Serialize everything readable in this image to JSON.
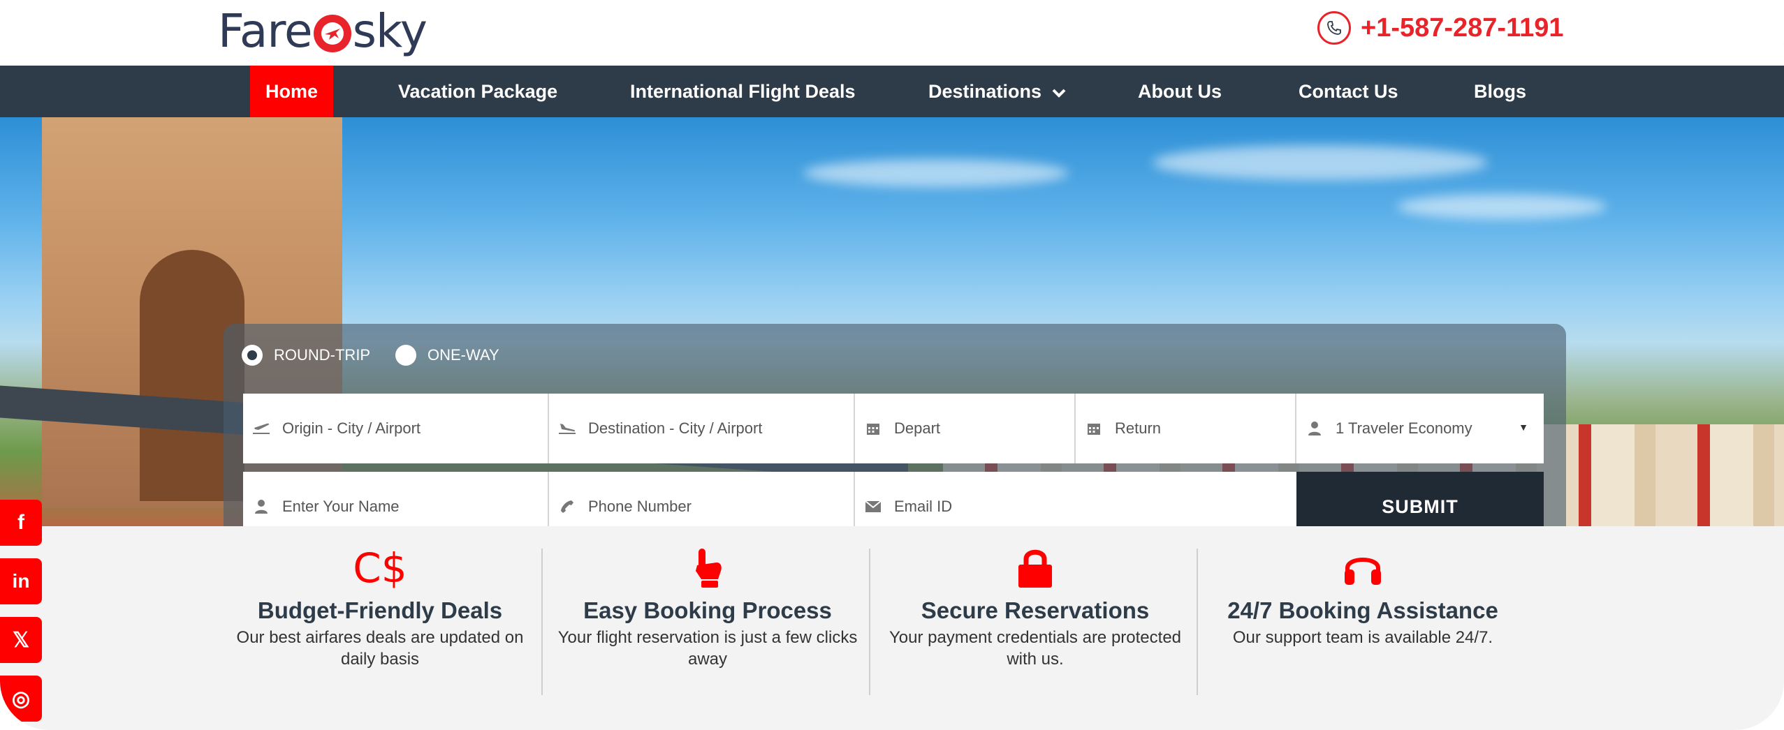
{
  "brand": {
    "logo_left": "Fare",
    "logo_right": "sky"
  },
  "header": {
    "phone": "+1-587-287-1191"
  },
  "nav": {
    "items": [
      {
        "label": "Home",
        "active": true
      },
      {
        "label": "Vacation Package"
      },
      {
        "label": "International Flight Deals"
      },
      {
        "label": "Destinations",
        "has_dropdown": true
      },
      {
        "label": "About Us"
      },
      {
        "label": "Contact Us"
      },
      {
        "label": "Blogs"
      }
    ]
  },
  "search": {
    "trip_types": [
      {
        "label": "ROUND-TRIP",
        "selected": true
      },
      {
        "label": "ONE-WAY",
        "selected": false
      }
    ],
    "origin_placeholder": "Origin - City / Airport",
    "destination_placeholder": "Destination - City / Airport",
    "depart_placeholder": "Depart",
    "return_placeholder": "Return",
    "travelers_value": "1 Traveler Economy",
    "name_placeholder": "Enter Your Name",
    "phone_placeholder": "Phone Number",
    "email_placeholder": "Email ID",
    "submit_label": "SUBMIT"
  },
  "social": [
    {
      "icon": "facebook-icon",
      "glyph": "f"
    },
    {
      "icon": "linkedin-icon",
      "glyph": "in"
    },
    {
      "icon": "x-icon",
      "glyph": "𝕏"
    },
    {
      "icon": "instagram-icon",
      "glyph": "◎"
    }
  ],
  "features": [
    {
      "icon_text": "C$",
      "title": "Budget-Friendly Deals",
      "desc": "Our best airfares deals are updated on daily basis"
    },
    {
      "title": "Easy Booking Process",
      "desc": "Your flight reservation is just a few clicks away"
    },
    {
      "title": "Secure Reservations",
      "desc": "Your payment credentials are protected with us."
    },
    {
      "title": "24/7 Booking Assistance",
      "desc": "Our support team is available 24/7."
    }
  ],
  "colors": {
    "accent": "#ff0000",
    "nav_bg": "#2e3b49",
    "submit_bg": "#202a35"
  }
}
